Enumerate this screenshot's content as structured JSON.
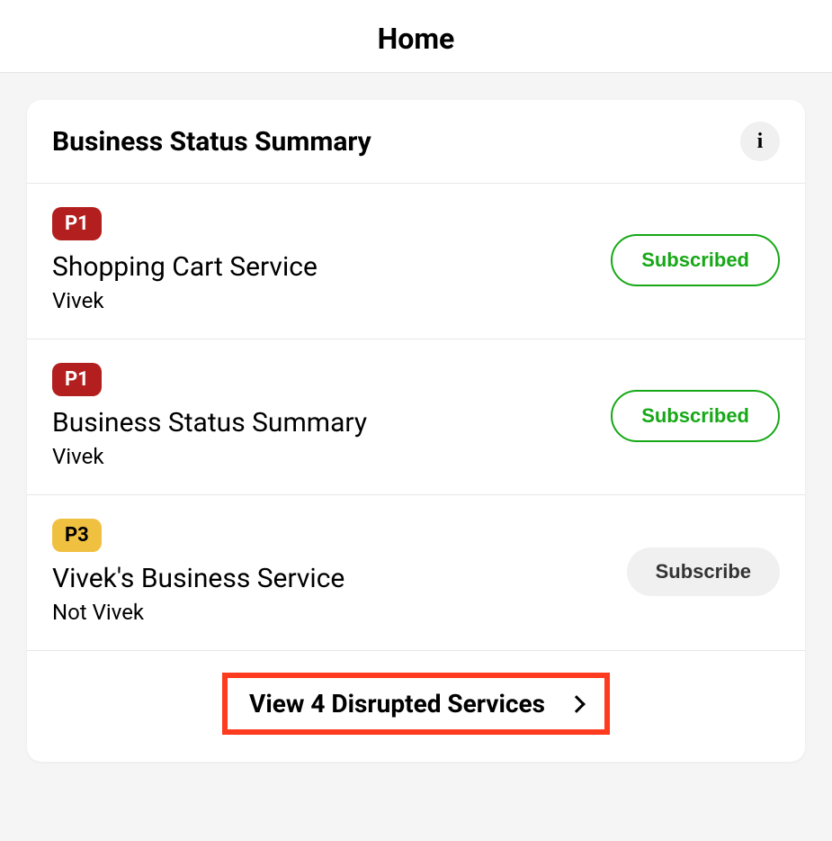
{
  "header": {
    "title": "Home"
  },
  "summary": {
    "title": "Business Status Summary",
    "info_icon": "i",
    "services": [
      {
        "priority": "P1",
        "priority_class": "priority-p1",
        "name": "Shopping Cart Service",
        "owner": "Vivek",
        "subscribe_label": "Subscribed",
        "subscribe_class": "subscribed"
      },
      {
        "priority": "P1",
        "priority_class": "priority-p1",
        "name": "Business Status Summary",
        "owner": "Vivek",
        "subscribe_label": "Subscribed",
        "subscribe_class": "subscribed"
      },
      {
        "priority": "P3",
        "priority_class": "priority-p3",
        "name": "Vivek's Business Service",
        "owner": "Not Vivek",
        "subscribe_label": "Subscribe",
        "subscribe_class": "not-subscribed"
      }
    ],
    "footer_label": "View 4 Disrupted Services"
  }
}
